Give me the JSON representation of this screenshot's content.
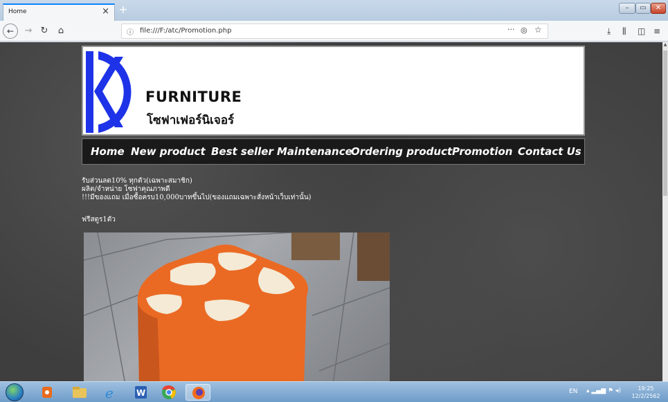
{
  "browser": {
    "tab_title": "Home",
    "tab_close": "×",
    "new_tab": "+",
    "url": "file:///F:/atc/Promotion.php",
    "window_buttons": {
      "minimize": "–",
      "maximize": "▭",
      "close": "✕"
    }
  },
  "site": {
    "brand": "FURNITURE",
    "brand_thai": "โซฟาเฟอร์นิเจอร์",
    "menu": [
      {
        "label": "Home"
      },
      {
        "label": "New product"
      },
      {
        "label": "Best seller"
      },
      {
        "label": "Maintenance"
      },
      {
        "label": "Ordering product"
      },
      {
        "label": "Promotion"
      },
      {
        "label": "Contact Us"
      }
    ],
    "promo_lines": [
      "รับส่วนลด10% ทุกตัว(เฉพาะสมาชิก)",
      "ผลิต/จำหน่าย โซฟาคุณภาพดี",
      "!!!มีของแถม เมื่อซื้อครบ10,000บาทขึ้นไป(ของแถมเฉพาะสั่งหน้าเว็บเท่านั้น)"
    ],
    "free_text": "ฟรีสตูร1ตัว"
  },
  "taskbar": {
    "lang": "EN",
    "clock_time": "19:25",
    "clock_date": "12/2/2562"
  },
  "colors": {
    "logo_blue": "#1e33e8",
    "menu_bg": "#1a1a1a",
    "stool_orange": "#ea6a24",
    "stool_cream": "#f4ead6"
  }
}
